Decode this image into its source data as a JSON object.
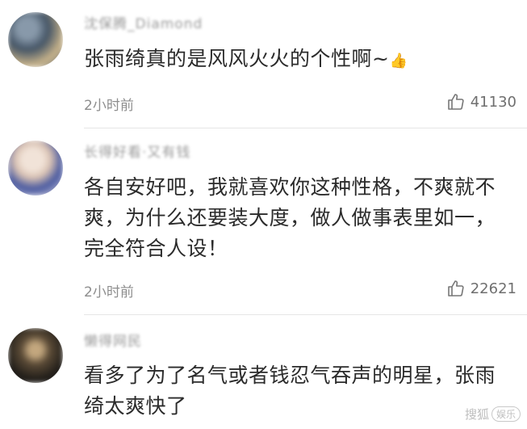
{
  "comments": [
    {
      "username": "沈保腾_Diamond",
      "text": "张雨绮真的是风风火火的个性啊~",
      "emoji": "👍",
      "time": "2小时前",
      "likes": "41130",
      "avatar_colors": [
        "#6d7c8c",
        "#c9b48a"
      ]
    },
    {
      "username": "长得好看·又有钱",
      "text": "各自安好吧，我就喜欢你这种性格，不爽就不爽，为什么还要装大度，做人做事表里如一，完全符合人设！",
      "time": "2小时前",
      "likes": "22621",
      "avatar_colors": [
        "#d9c7b8",
        "#3e4e8c"
      ]
    },
    {
      "username": "懒得网民",
      "text": "看多了为了名气或者钱忍气吞声的明星，张雨绮太爽快了",
      "avatar_colors": [
        "#2a2620",
        "#b59a72"
      ]
    }
  ],
  "watermark": {
    "brand": "搜狐",
    "badge": "娱乐"
  },
  "icons": {
    "like": "thumbs-up-icon"
  }
}
